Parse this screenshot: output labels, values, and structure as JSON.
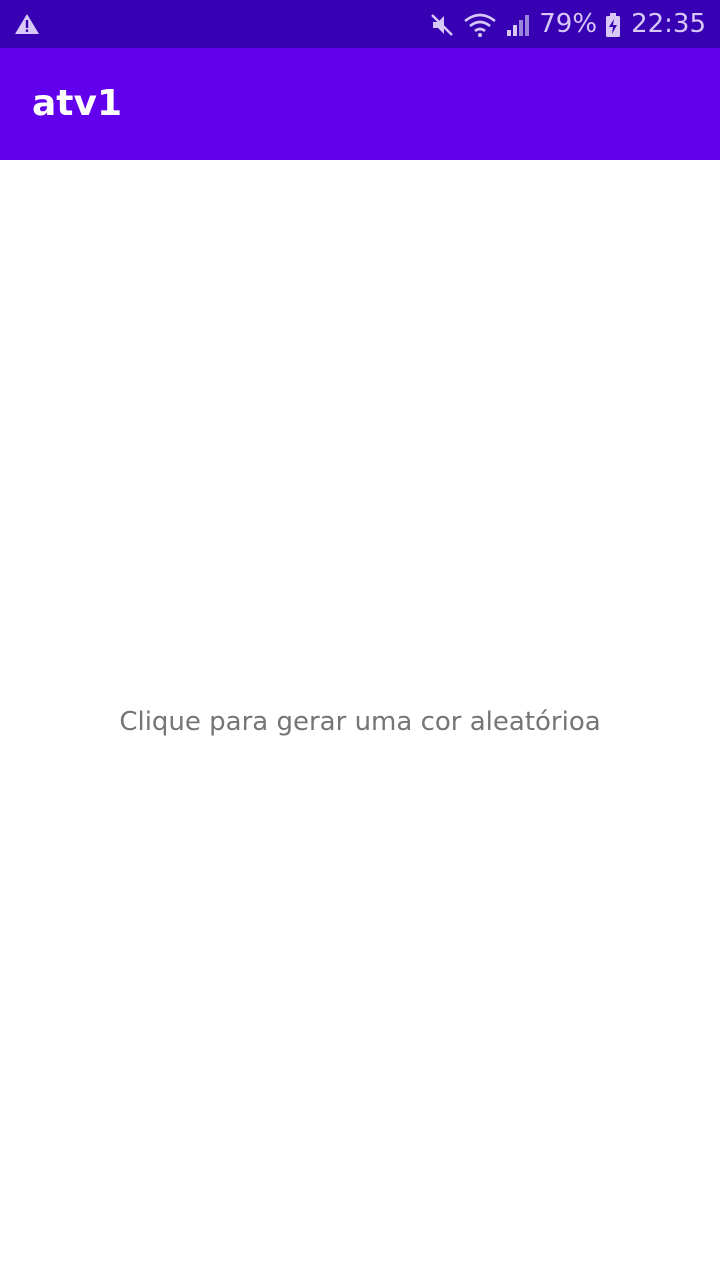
{
  "status_bar": {
    "battery_percent": "79%",
    "time": "22:35",
    "icons": [
      "warning-icon",
      "mute-icon",
      "wifi-icon",
      "signal-icon",
      "battery-charging-icon"
    ],
    "background": "#3700b3"
  },
  "app_bar": {
    "title": "atv1",
    "background": "#6200ee"
  },
  "main": {
    "prompt_text": "Clique para gerar uma cor aleatórioa",
    "background": "#ffffff"
  }
}
